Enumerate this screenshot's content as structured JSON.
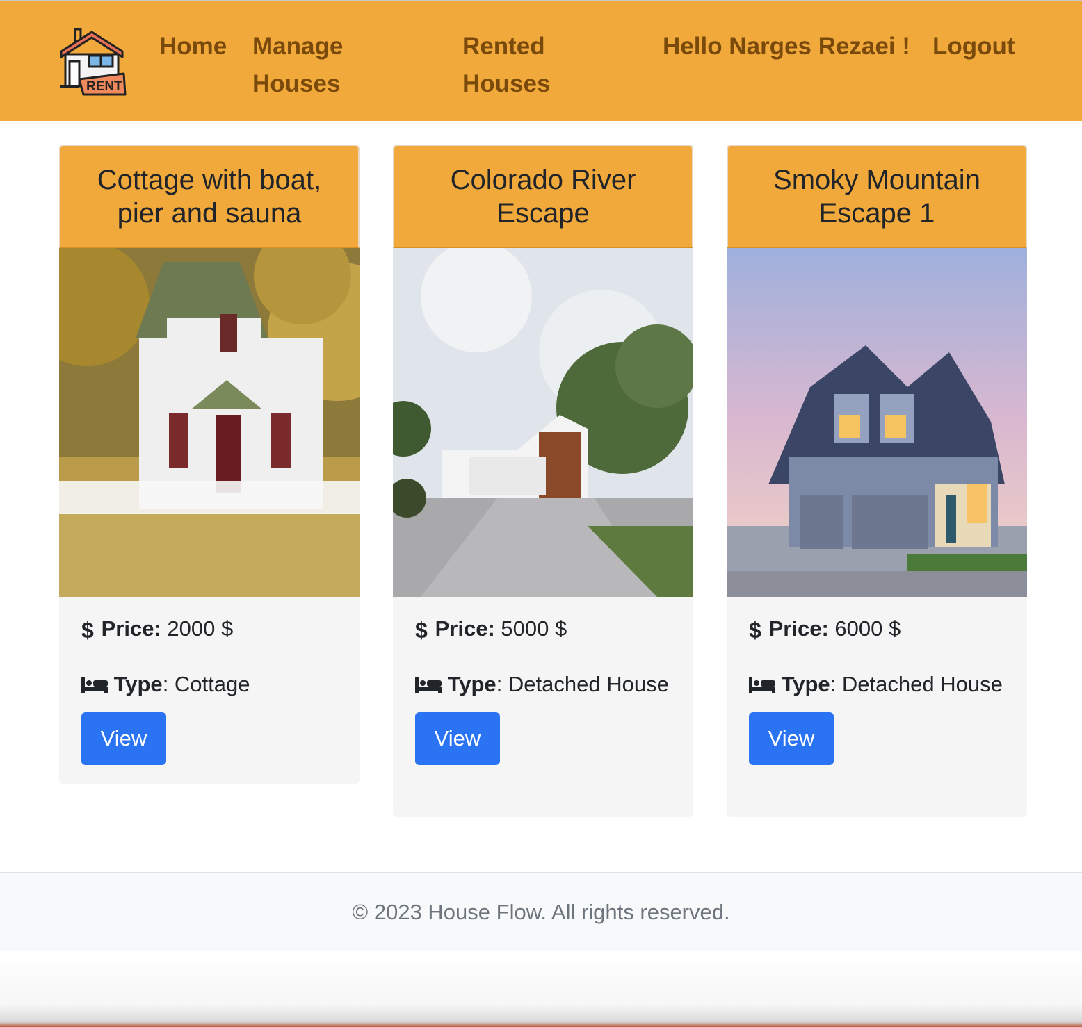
{
  "nav": {
    "logo_text": "RENT",
    "home": "Home",
    "manage": "Manage Houses",
    "rented": "Rented Houses",
    "greeting": "Hello Narges Rezaei !",
    "logout": "Logout"
  },
  "colors": {
    "brand": "#f2a93b",
    "nav_text": "#7a4a0c",
    "button": "#2a73f2"
  },
  "houses": [
    {
      "title": "Cottage with boat, pier and sauna",
      "price_label": "Price:",
      "price": "2000 $",
      "type_label": "Type",
      "type": "Cottage",
      "button": "View"
    },
    {
      "title": "Colorado River Escape",
      "price_label": "Price:",
      "price": "5000 $",
      "type_label": "Type",
      "type": "Detached House",
      "button": "View"
    },
    {
      "title": "Smoky Mountain Escape 1",
      "price_label": "Price:",
      "price": "6000 $",
      "type_label": "Type",
      "type": "Detached House",
      "button": "View"
    }
  ],
  "icons": {
    "price": "dollar-icon",
    "type": "bed-icon",
    "logo": "house-rent-icon"
  },
  "footer": {
    "text": "© 2023 House Flow. All rights reserved."
  }
}
